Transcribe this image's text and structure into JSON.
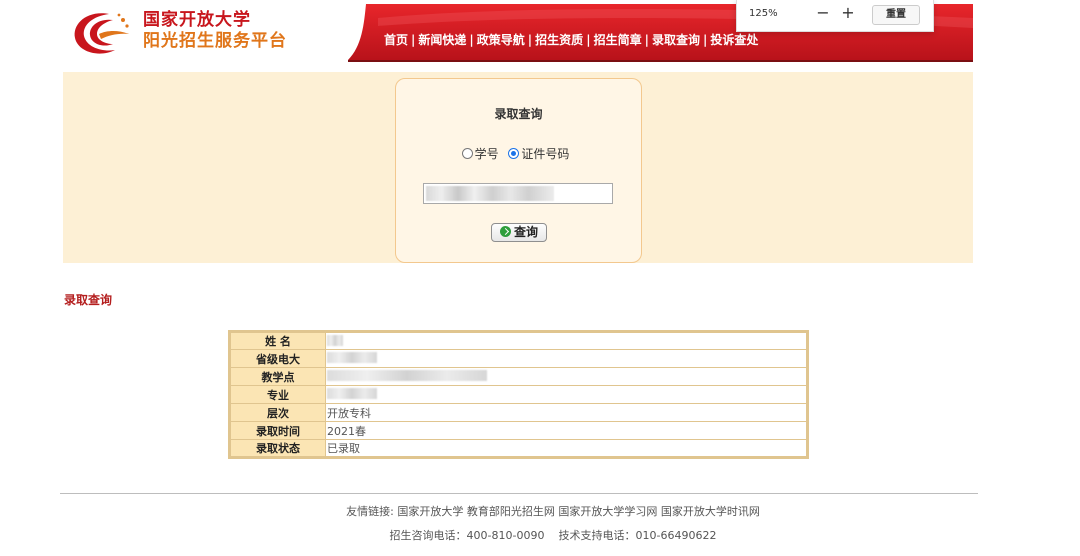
{
  "header": {
    "logo_line1": "国家开放大学",
    "logo_line2": "阳光招生服务平台",
    "nav_items": [
      "首页",
      "新闻快递",
      "政策导航",
      "招生资质",
      "招生简章",
      "录取查询",
      "投诉查处"
    ],
    "brand_red": "#c8161d",
    "brand_orange": "#e0761b"
  },
  "zoom_popup": {
    "level": "125%",
    "minus": "−",
    "plus": "+",
    "reset": "重置"
  },
  "search_card": {
    "title": "录取查询",
    "options": [
      {
        "label": "学号",
        "selected": false
      },
      {
        "label": "证件号码",
        "selected": true
      }
    ],
    "button_label": "查询"
  },
  "result": {
    "section_title": "录取查询",
    "rows": [
      {
        "label": "姓 名",
        "value": ""
      },
      {
        "label": "省级电大",
        "value": ""
      },
      {
        "label": "教学点",
        "value": ""
      },
      {
        "label": "专业",
        "value": ""
      },
      {
        "label": "层次",
        "value": "开放专科"
      },
      {
        "label": "录取时间",
        "value": "2021春"
      },
      {
        "label": "录取状态",
        "value": "已录取"
      }
    ]
  },
  "footer": {
    "links_prefix": "友情链接:",
    "links": [
      "国家开放大学",
      "教育部阳光招生网",
      "国家开放大学学习网",
      "国家开放大学时讯网"
    ],
    "consult": "招生咨询电话：400-810-0090",
    "support": "技术支持电话：010-66490622"
  }
}
